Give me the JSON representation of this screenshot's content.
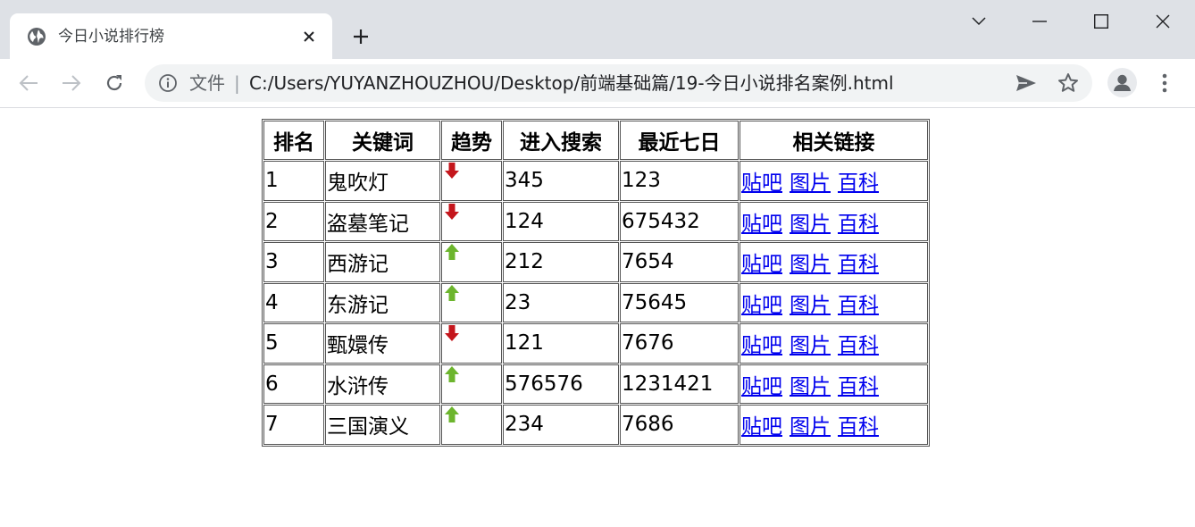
{
  "browser": {
    "tab_title": "今日小说排行榜",
    "address_scheme": "文件",
    "address_separator": "|",
    "address_url": "C:/Users/YUYANZHOUZHOU/Desktop/前端基础篇/19-今日小说排名案例.html"
  },
  "table": {
    "headers": [
      "排名",
      "关键词",
      "趋势",
      "进入搜索",
      "最近七日",
      "相关链接"
    ],
    "link_labels": [
      "贴吧",
      "图片",
      "百科"
    ],
    "rows": [
      {
        "rank": "1",
        "keyword": "鬼吹灯",
        "trend": "down",
        "search": "345",
        "week": "123"
      },
      {
        "rank": "2",
        "keyword": "盗墓笔记",
        "trend": "down",
        "search": "124",
        "week": "675432"
      },
      {
        "rank": "3",
        "keyword": "西游记",
        "trend": "up",
        "search": "212",
        "week": "7654"
      },
      {
        "rank": "4",
        "keyword": "东游记",
        "trend": "up",
        "search": "23",
        "week": "75645"
      },
      {
        "rank": "5",
        "keyword": "甄嬛传",
        "trend": "down",
        "search": "121",
        "week": "7676"
      },
      {
        "rank": "6",
        "keyword": "水浒传",
        "trend": "up",
        "search": "576576",
        "week": "1231421"
      },
      {
        "rank": "7",
        "keyword": "三国演义",
        "trend": "up",
        "search": "234",
        "week": "7686"
      }
    ]
  },
  "colors": {
    "trend_down": "#c4161c",
    "trend_up": "#6cb52d",
    "link": "#0000ee"
  },
  "icons": {
    "tab_favicon": "globe-icon",
    "tab_close": "close-icon",
    "new_tab": "plus-icon",
    "back": "back-arrow-icon",
    "forward": "forward-arrow-icon",
    "reload": "reload-icon",
    "site_info": "info-icon",
    "send": "send-icon",
    "bookmark": "star-icon",
    "profile": "avatar-icon",
    "menu": "menu-dots-icon"
  }
}
